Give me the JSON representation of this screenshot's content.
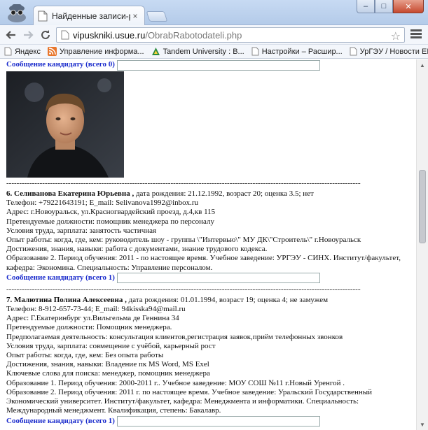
{
  "browser": {
    "tab_title": "Найденные записи-резюме",
    "tab_close": "×",
    "url_host": "vipuskniki.usue.ru",
    "url_path": "/ObrabRabotodateli.php",
    "window_buttons": {
      "minimize": "–",
      "maximize": "□",
      "close": "✕"
    }
  },
  "bookmarks": [
    {
      "label": "Яндекс",
      "icon": "yandex-icon",
      "color": "#ffffff"
    },
    {
      "label": "Управление информа...",
      "icon": "rss-icon",
      "color": "#e8762c"
    },
    {
      "label": "Tandem University : В...",
      "icon": "tandem-icon",
      "color": "#2b8a3e"
    },
    {
      "label": "Настройки – Расшир...",
      "icon": "page-icon",
      "color": "#ffffff"
    },
    {
      "label": "УрГЭУ / Новости ЕИС...",
      "icon": "page-icon",
      "color": "#ffffff"
    }
  ],
  "content": {
    "msg_top": "Сообщение кандидату (всего 0)",
    "separator": "------------------------------------------------------------------------------------------------------------------------------------------------------------",
    "candidate6": {
      "name": "6. Селиванова Екатерина Юрьевна ,",
      "meta": " дата рождения: 21.12.1992, возраст 20; оценка 3.5; нет",
      "lines": [
        "Телефон: +79221643191; E_mail: Selivanova1992@inbox.ru",
        "Адрес: г.Новоуральск, ул.Красногвардейский проезд, д.4,кв 115",
        "Претендуемые должности: помощник менеджера по персоналу",
        "Условия труда, зарплата: занятость частичная",
        "Опыт работы: когда, где, кем: руководитель шоу - группы \\\"Интервью\\\" МУ ДК\\\"Строитель\\\" г.Новоуральск",
        "Достижения, знания, навыки: работа с документами, знание трудового кодекса.",
        "Образование 2. Период обучения: 2011 - по настоящее время. Учебное заведение: УРГЭУ - СИНХ. Институт/факультет,",
        "кафедра: Экономика. Специальность: Управление персоналом."
      ],
      "msg": "Сообщение кандидату (всего 1)"
    },
    "candidate7": {
      "name": "7. Малютина Полина Алексеевна ,",
      "meta": " дата рождения: 01.01.1994, возраст 19; оценка 4; не замужем",
      "lines": [
        "Телефон: 8-912-657-73-44; E_mail: 94kisska94@mail.ru",
        "Адрес: Г.Екатеринбург ул.Вильгельма де Геннина 34",
        "Претендуемые должности: Помощник менеджера.",
        "Предполагаемая деятельность: консультация клиентов,регистрация заявок,приём телефонных звонков",
        "Условия труда, зарплата: совмещение с учёбой, карьерный рост",
        "Опыт работы: когда, где, кем: Без опыта работы",
        "Достижения, знания, навыки: Владение пк MS Word, MS Exel",
        "Ключевые слова для поиска: менеджер, помощник менеджера",
        "Образование 1. Период обучения: 2000-2011 г.. Учебное заведение: МОУ СОШ №11 г.Новый Уренгой .",
        "Образование 2. Период обучения: 2011 г. по настоящее время. Учебное заведение: Уральский Государственный",
        "Экономический университет. Институт/факультет, кафедра: Менеджмента и информатики. Специальность:",
        "Международный менеджмент. Квалификация, степень: Бакалавр."
      ],
      "msg": "Сообщение кандидату (всего 1)"
    }
  },
  "colors": {
    "link_blue": "#1a2bcc",
    "titlebar": "#b4cbe9"
  }
}
